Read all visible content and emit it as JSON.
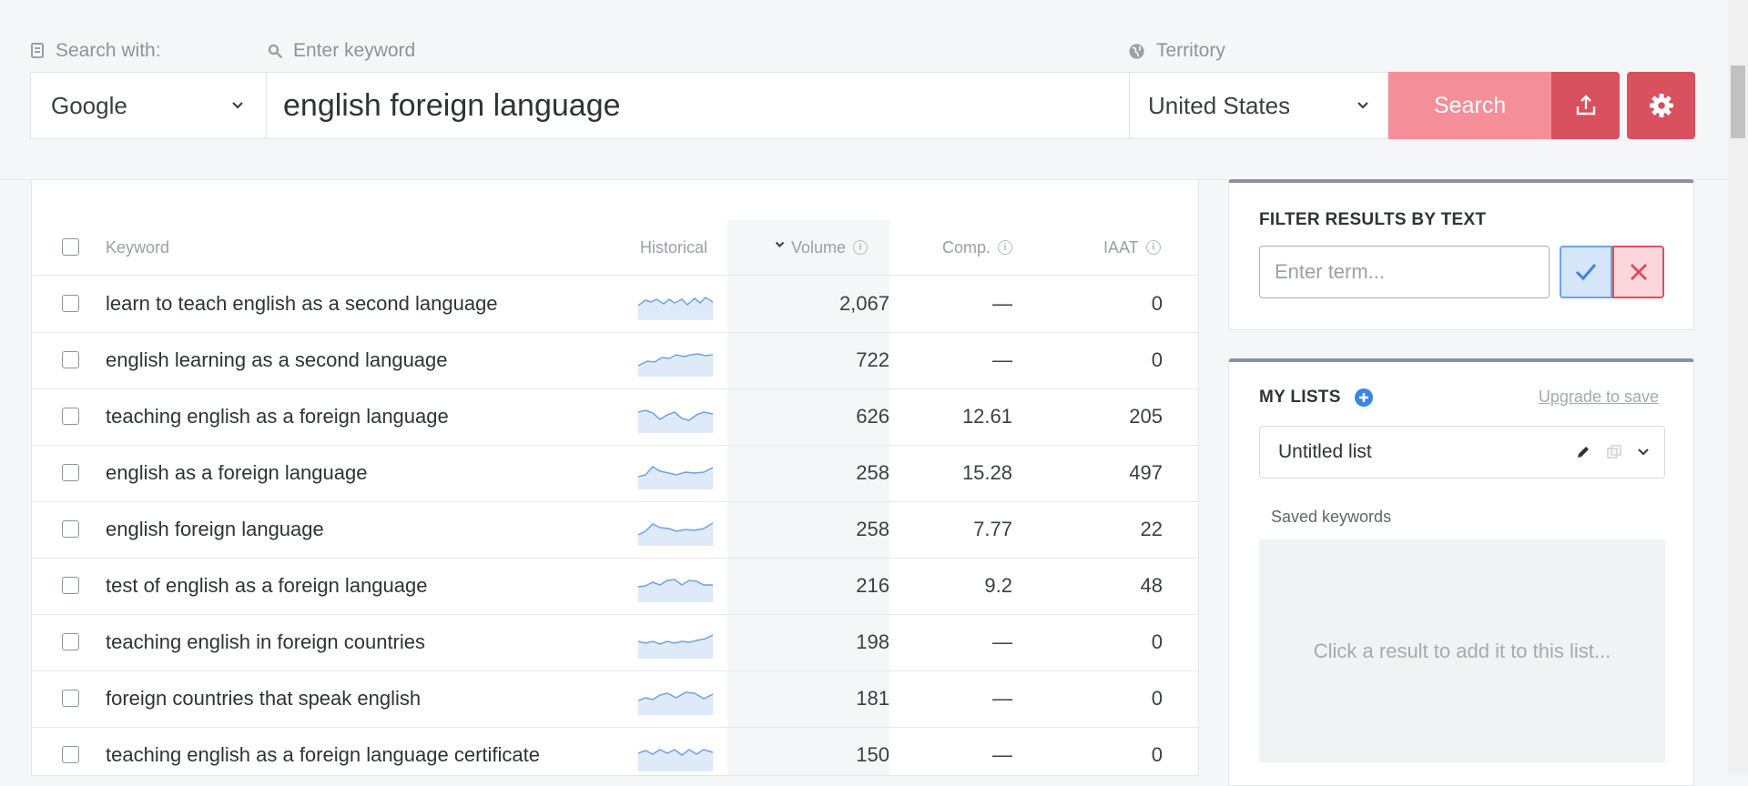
{
  "search": {
    "engine_label": "Search with:",
    "engine_value": "Google",
    "keyword_label": "Enter keyword",
    "keyword_value": "english foreign language",
    "territory_label": "Territory",
    "territory_value": "United States",
    "search_button": "Search"
  },
  "table": {
    "headers": {
      "keyword": "Keyword",
      "historical": "Historical",
      "volume": "Volume",
      "comp": "Comp.",
      "iaat": "IAAT"
    },
    "rows": [
      {
        "keyword": "learn to teach english as a second language",
        "volume": "2,067",
        "comp": "—",
        "iaat": "0"
      },
      {
        "keyword": "english learning as a second language",
        "volume": "722",
        "comp": "—",
        "iaat": "0"
      },
      {
        "keyword": "teaching english as a foreign language",
        "volume": "626",
        "comp": "12.61",
        "iaat": "205"
      },
      {
        "keyword": "english as a foreign language",
        "volume": "258",
        "comp": "15.28",
        "iaat": "497"
      },
      {
        "keyword": "english foreign language",
        "volume": "258",
        "comp": "7.77",
        "iaat": "22"
      },
      {
        "keyword": "test of english as a foreign language",
        "volume": "216",
        "comp": "9.2",
        "iaat": "48"
      },
      {
        "keyword": "teaching english in foreign countries",
        "volume": "198",
        "comp": "—",
        "iaat": "0"
      },
      {
        "keyword": "foreign countries that speak english",
        "volume": "181",
        "comp": "—",
        "iaat": "0"
      },
      {
        "keyword": "teaching english as a foreign language certificate",
        "volume": "150",
        "comp": "—",
        "iaat": "0"
      }
    ]
  },
  "filter": {
    "title": "FILTER RESULTS BY TEXT",
    "placeholder": "Enter term..."
  },
  "lists": {
    "title": "MY LISTS",
    "upgrade_link": "Upgrade to save",
    "selected_list": "Untitled list",
    "saved_label": "Saved keywords",
    "empty_text": "Click a result to add it to this list..."
  },
  "colors": {
    "accent_red": "#d9505e",
    "search_pink": "#f48f9a",
    "link_blue": "#3a86e0"
  }
}
